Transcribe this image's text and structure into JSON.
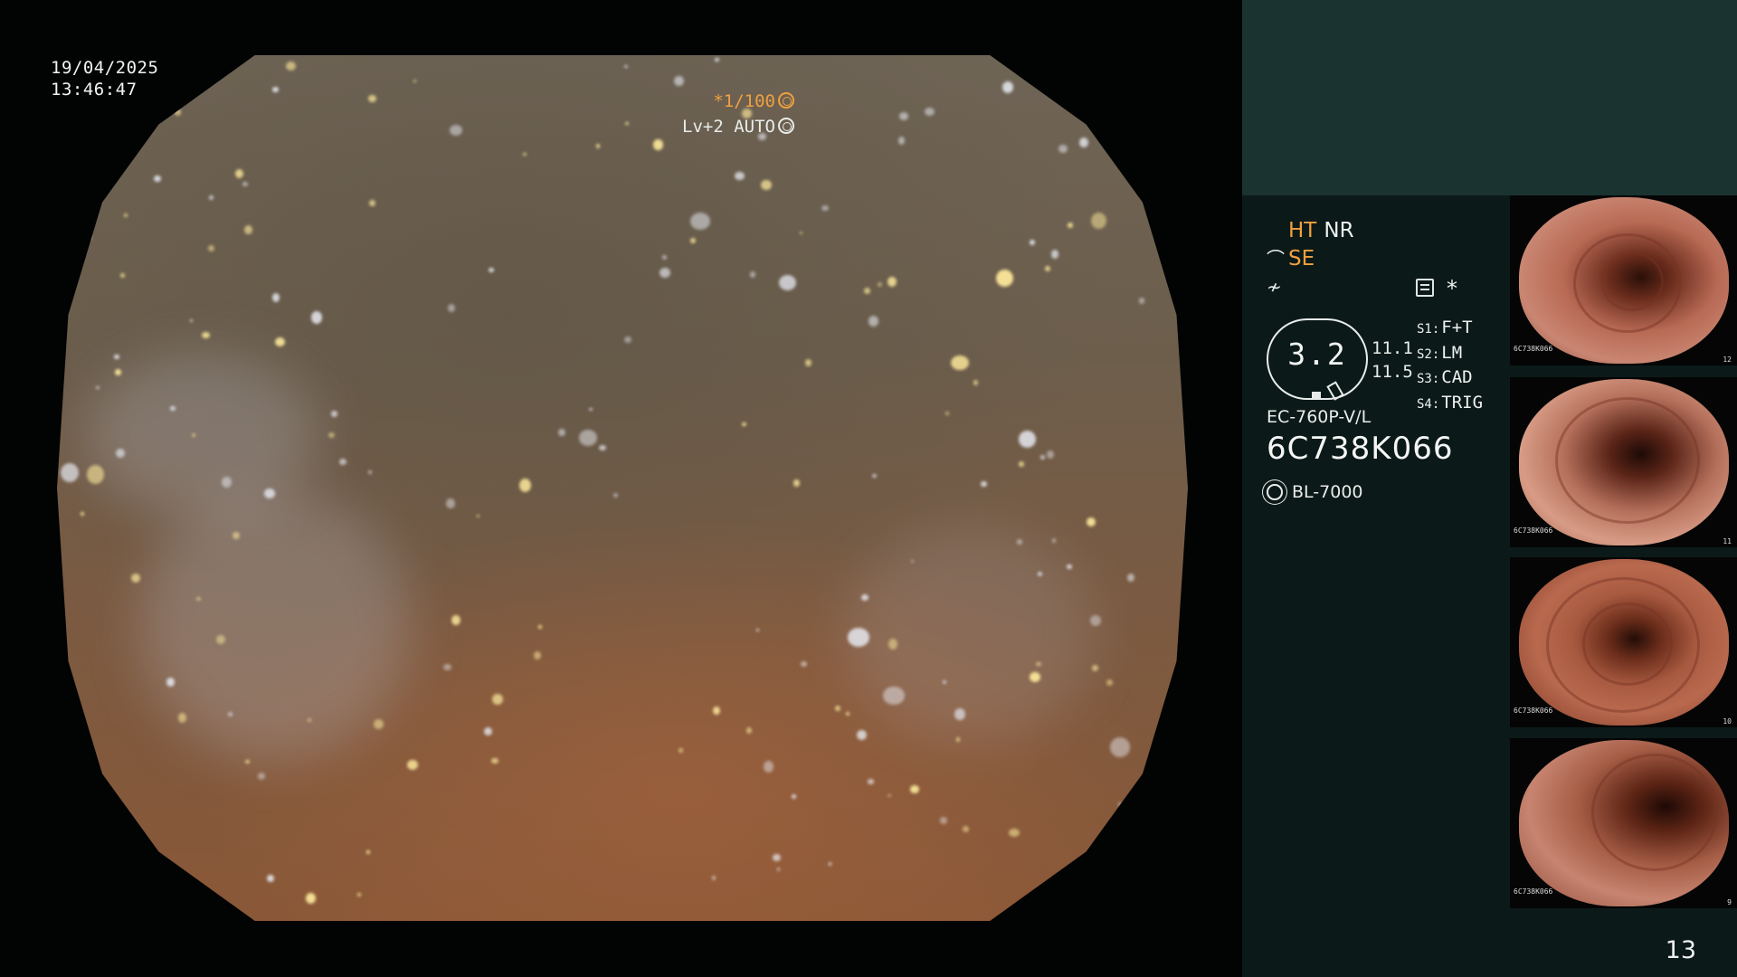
{
  "main": {
    "date": "19/04/2025",
    "time": "13:46:47",
    "shutter": "*1/100",
    "exposure": "Lv+2 AUTO"
  },
  "panel": {
    "ht": "HT",
    "nr": "NR",
    "se": "SE",
    "zoom_value": "3.2",
    "readings": [
      "11.1",
      "11.5"
    ],
    "s_buttons": [
      {
        "key": "S1:",
        "value": "F+T"
      },
      {
        "key": "S2:",
        "value": "LM"
      },
      {
        "key": "S3:",
        "value": "CAD"
      },
      {
        "key": "S4:",
        "value": "TRIG"
      }
    ],
    "scope_model": "EC-760P-V/L",
    "serial": "6C738K066",
    "light_source": "BL-7000",
    "page_number": "13"
  },
  "thumbnails": [
    {
      "serial": "6C738K066",
      "number": "12"
    },
    {
      "serial": "6C738K066",
      "number": "11"
    },
    {
      "serial": "6C738K066",
      "number": "10"
    },
    {
      "serial": "6C738K066",
      "number": "9"
    }
  ],
  "colors": {
    "accent_orange": "#f0a040",
    "panel_top": "#1b3330",
    "panel_bottom": "#0b1a18"
  },
  "icons": [
    "shutter-icon",
    "auto-icon",
    "menu-icon",
    "light-source-icon"
  ]
}
